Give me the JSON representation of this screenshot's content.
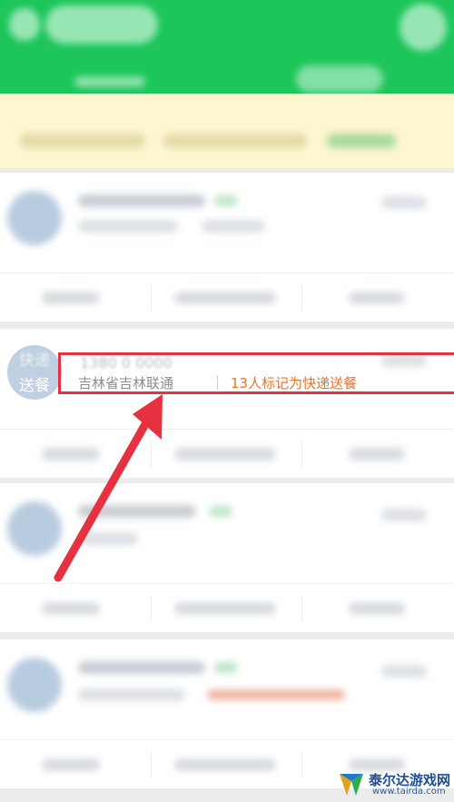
{
  "highlighted_item": {
    "avatar_label": "送餐",
    "location": "吉林省吉林联通",
    "mark_text": "13人标记为快递送餐"
  },
  "watermark": {
    "name": "泰尔达游戏网",
    "url": "www.tairda.com"
  },
  "colors": {
    "header_green": "#1cc65a",
    "highlight_border": "#e63240",
    "arrow": "#e63240",
    "mark_orange": "#e8752b"
  }
}
